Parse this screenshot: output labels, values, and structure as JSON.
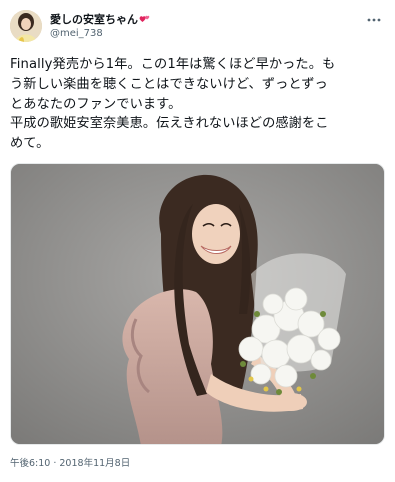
{
  "author": {
    "display_name": "愛しの安室ちゃん",
    "heart": "💕",
    "handle": "@mei_738"
  },
  "tweet": {
    "text": "Finally発売から1年。この1年は驚くほど早かった。も\nう新しい楽曲を聴くことはできないけど、ずっとずっ\nとあなたのファンでいます。\n平成の歌姫安室奈美恵。伝えきれないほどの感謝をこ\nめて。",
    "timestamp": "午後6:10 · 2018年11月8日"
  },
  "icons": {
    "more": "more-horizontal-icon"
  },
  "colors": {
    "text": "#0f1419",
    "muted": "#536471",
    "heart": "#e0245e"
  }
}
